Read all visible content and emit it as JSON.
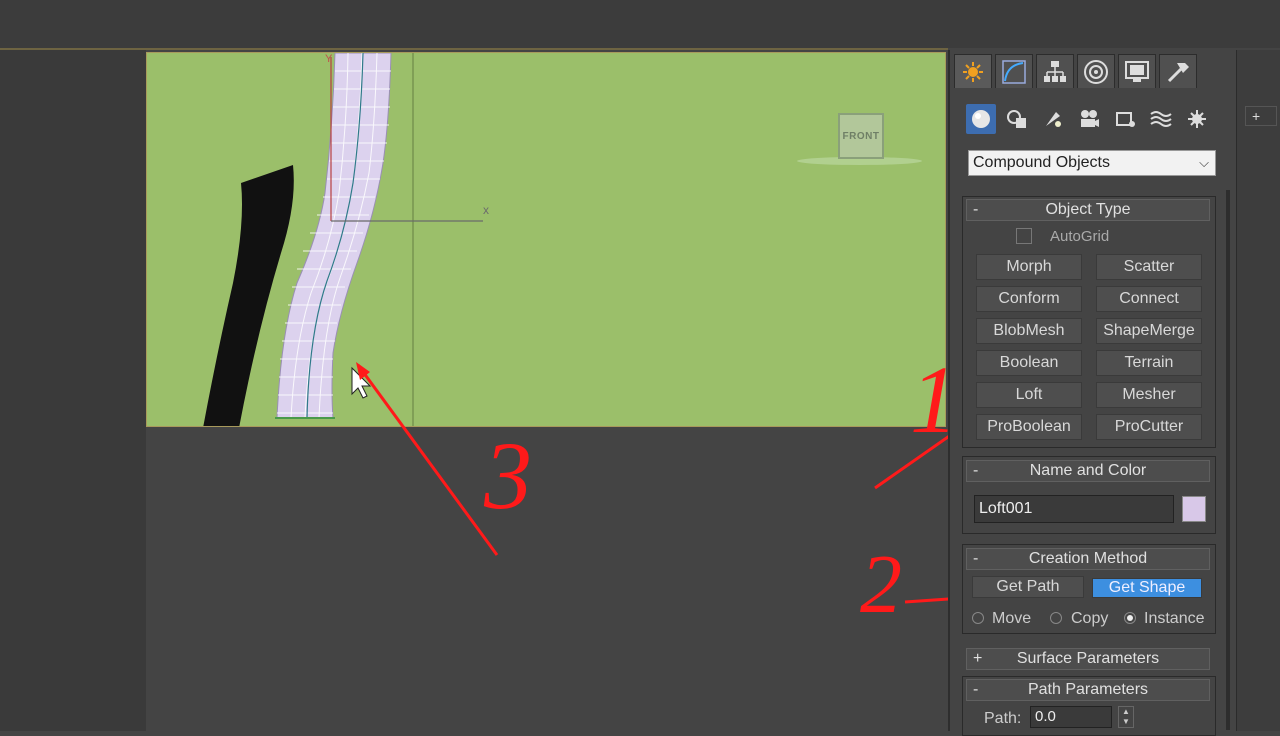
{
  "viewport": {
    "view_label": "FRONT",
    "x_axis_label": "x",
    "y_axis_label": "Y"
  },
  "annotations": {
    "marker_1": "1",
    "marker_2": "2",
    "marker_3": "3",
    "color": "#ff1a1a"
  },
  "command_panel": {
    "tabs": [
      {
        "name": "create",
        "icon": "sun-icon"
      },
      {
        "name": "modify",
        "icon": "curve-icon"
      },
      {
        "name": "hierarchy",
        "icon": "hierarchy-icon"
      },
      {
        "name": "motion",
        "icon": "motion-icon"
      },
      {
        "name": "display",
        "icon": "monitor-icon"
      },
      {
        "name": "utilities",
        "icon": "hammer-icon"
      }
    ],
    "categories": [
      "sphere-icon",
      "shapes-icon",
      "lights-icon",
      "cameras-icon",
      "helpers-icon",
      "spacewarps-icon",
      "systems-icon"
    ],
    "dropdown_value": "Compound Objects",
    "object_type": {
      "header": "Object Type",
      "sign": "-",
      "autogrid": "AutoGrid",
      "buttons": [
        "Morph",
        "Scatter",
        "Conform",
        "Connect",
        "BlobMesh",
        "ShapeMerge",
        "Boolean",
        "Terrain",
        "Loft",
        "Mesher",
        "ProBoolean",
        "ProCutter"
      ]
    },
    "name_and_color": {
      "header": "Name and Color",
      "sign": "-",
      "name_value": "Loft001",
      "color": "#d8c8e8"
    },
    "creation_method": {
      "header": "Creation Method",
      "sign": "-",
      "get_path": "Get Path",
      "get_shape": "Get Shape",
      "radio_move": "Move",
      "radio_copy": "Copy",
      "radio_instance": "Instance"
    },
    "surface_parameters": {
      "header": "Surface Parameters",
      "sign": "+"
    },
    "path_parameters": {
      "header": "Path Parameters",
      "sign": "-",
      "path_label": "Path:",
      "path_value": "0.0"
    }
  },
  "right_strip": {
    "plus": "+"
  }
}
